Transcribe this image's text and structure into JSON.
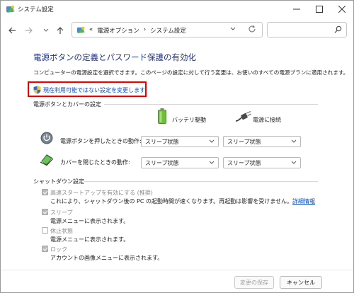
{
  "window": {
    "title": "システム設定"
  },
  "address": {
    "prefix": "«",
    "crumb1": "電源オプション",
    "separator": "›",
    "crumb2": "システム設定"
  },
  "page": {
    "heading": "電源ボタンの定義とパスワード保護の有効化",
    "description": "コンピューターの電源設定を選択できます。このページの設定に対して行う変更は、お使いのすべての電源プランに適用されます。",
    "change_link": "現在利用可能ではない設定を変更します"
  },
  "power_section": {
    "title": "電源ボタンとカバーの設定",
    "col_battery": "バッテリ駆動",
    "col_plugged": "電源に接続",
    "rows": [
      {
        "label": "電源ボタンを押したときの動作:",
        "battery": "スリープ状態",
        "plugged": "スリープ状態"
      },
      {
        "label": "カバーを閉じたときの動作:",
        "battery": "スリープ状態",
        "plugged": "スリープ状態"
      }
    ]
  },
  "shutdown_section": {
    "title": "シャットダウン設定",
    "items": [
      {
        "label": "高速スタートアップを有効にする (推奨)",
        "checked": true,
        "sub": "これにより、シャットダウン後の PC の起動時間が速くなります。再起動は影響を受けません。",
        "link": "詳細情報"
      },
      {
        "label": "スリープ",
        "checked": true,
        "sub": "電源メニューに表示されます。"
      },
      {
        "label": "休止状態",
        "checked": false,
        "sub": "電源メニューに表示されます。"
      },
      {
        "label": "ロック",
        "checked": true,
        "sub": "アカウントの画像メニューに表示されます。"
      }
    ]
  },
  "footer": {
    "save": "変更の保存",
    "cancel": "キャンセル"
  },
  "colors": {
    "heading": "#1e3287",
    "link": "#0a4cbf",
    "highlight_box": "#e60000"
  }
}
